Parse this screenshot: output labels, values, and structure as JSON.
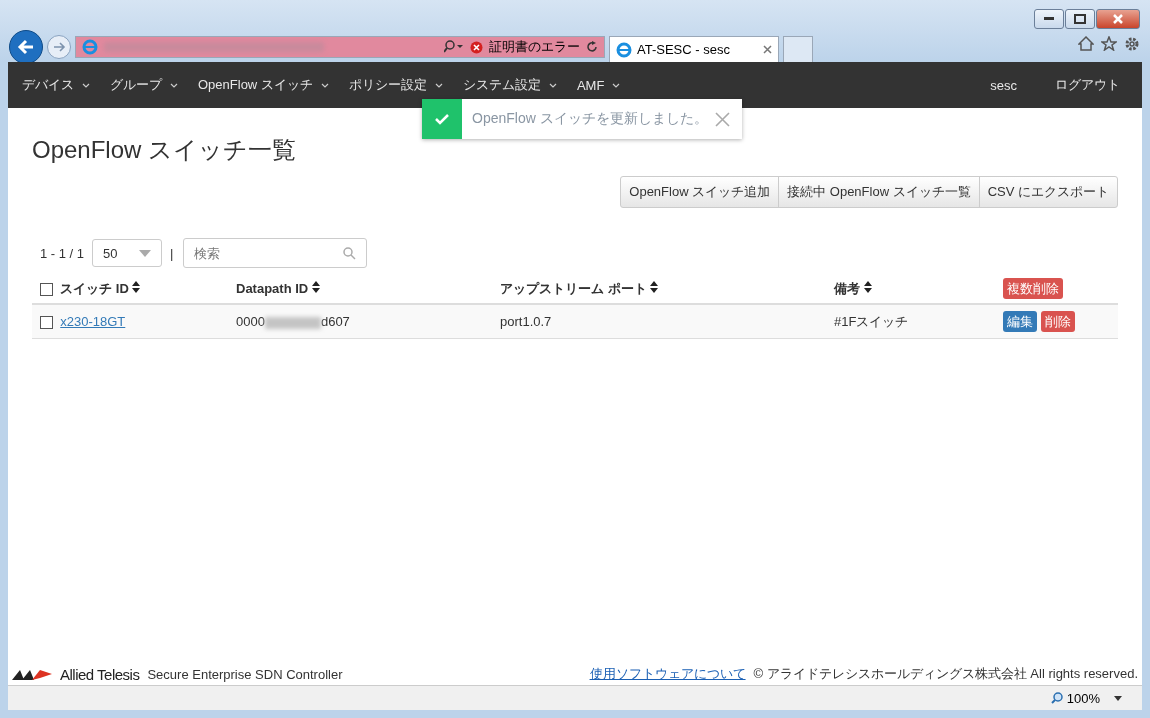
{
  "browser": {
    "security_warning": "証明書のエラー",
    "tabs": [
      {
        "label": "AT-SESC - sesc",
        "selected": true
      }
    ],
    "zoom": "100%"
  },
  "nav": {
    "items": [
      {
        "label": "デバイス",
        "dropdown": true
      },
      {
        "label": "グループ",
        "dropdown": true
      },
      {
        "label": "OpenFlow スイッチ",
        "dropdown": true
      },
      {
        "label": "ポリシー設定",
        "dropdown": true
      },
      {
        "label": "システム設定",
        "dropdown": true
      },
      {
        "label": "AMF",
        "dropdown": true
      }
    ],
    "user": "sesc",
    "logout": "ログアウト"
  },
  "toast": {
    "message": "OpenFlow スイッチを更新しました。"
  },
  "page": {
    "title": "OpenFlow スイッチ一覧",
    "actions": [
      "OpenFlow スイッチ追加",
      "接続中 OpenFlow スイッチ一覧",
      "CSV にエクスポート"
    ],
    "pager": {
      "range": "1 - 1 / 1",
      "page_size": "50",
      "separator": "|"
    },
    "search": {
      "placeholder": "検索"
    },
    "table": {
      "select_all_checked": false,
      "columns": [
        "スイッチ ID",
        "Datapath ID",
        "アップストリーム ポート",
        "備考"
      ],
      "bulk_delete": "複数削除",
      "rows": [
        {
          "checked": false,
          "switch_id": "x230-18GT",
          "datapath_prefix": "0000",
          "datapath_suffix": "d607",
          "upstream_port": "port1.0.7",
          "note": "#1Fスイッチ",
          "edit": "編集",
          "delete": "削除"
        }
      ]
    }
  },
  "footer": {
    "brand": "Allied Telesis",
    "product": "Secure Enterprise SDN Controller",
    "link": "使用ソフトウェアについて",
    "copyright": "© アライドテレシスホールディングス株式会社 All rights reserved."
  }
}
